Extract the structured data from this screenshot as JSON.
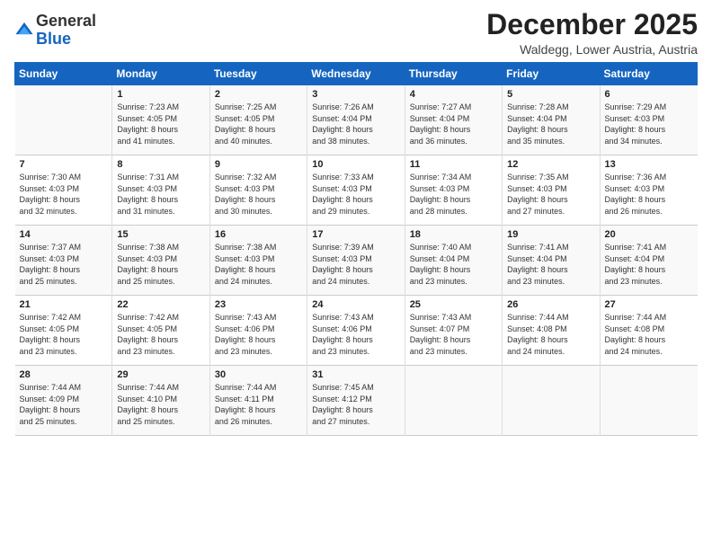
{
  "header": {
    "logo_general": "General",
    "logo_blue": "Blue",
    "month_title": "December 2025",
    "location": "Waldegg, Lower Austria, Austria"
  },
  "days_of_week": [
    "Sunday",
    "Monday",
    "Tuesday",
    "Wednesday",
    "Thursday",
    "Friday",
    "Saturday"
  ],
  "weeks": [
    [
      {
        "day": "",
        "info": ""
      },
      {
        "day": "1",
        "info": "Sunrise: 7:23 AM\nSunset: 4:05 PM\nDaylight: 8 hours\nand 41 minutes."
      },
      {
        "day": "2",
        "info": "Sunrise: 7:25 AM\nSunset: 4:05 PM\nDaylight: 8 hours\nand 40 minutes."
      },
      {
        "day": "3",
        "info": "Sunrise: 7:26 AM\nSunset: 4:04 PM\nDaylight: 8 hours\nand 38 minutes."
      },
      {
        "day": "4",
        "info": "Sunrise: 7:27 AM\nSunset: 4:04 PM\nDaylight: 8 hours\nand 36 minutes."
      },
      {
        "day": "5",
        "info": "Sunrise: 7:28 AM\nSunset: 4:04 PM\nDaylight: 8 hours\nand 35 minutes."
      },
      {
        "day": "6",
        "info": "Sunrise: 7:29 AM\nSunset: 4:03 PM\nDaylight: 8 hours\nand 34 minutes."
      }
    ],
    [
      {
        "day": "7",
        "info": "Sunrise: 7:30 AM\nSunset: 4:03 PM\nDaylight: 8 hours\nand 32 minutes."
      },
      {
        "day": "8",
        "info": "Sunrise: 7:31 AM\nSunset: 4:03 PM\nDaylight: 8 hours\nand 31 minutes."
      },
      {
        "day": "9",
        "info": "Sunrise: 7:32 AM\nSunset: 4:03 PM\nDaylight: 8 hours\nand 30 minutes."
      },
      {
        "day": "10",
        "info": "Sunrise: 7:33 AM\nSunset: 4:03 PM\nDaylight: 8 hours\nand 29 minutes."
      },
      {
        "day": "11",
        "info": "Sunrise: 7:34 AM\nSunset: 4:03 PM\nDaylight: 8 hours\nand 28 minutes."
      },
      {
        "day": "12",
        "info": "Sunrise: 7:35 AM\nSunset: 4:03 PM\nDaylight: 8 hours\nand 27 minutes."
      },
      {
        "day": "13",
        "info": "Sunrise: 7:36 AM\nSunset: 4:03 PM\nDaylight: 8 hours\nand 26 minutes."
      }
    ],
    [
      {
        "day": "14",
        "info": "Sunrise: 7:37 AM\nSunset: 4:03 PM\nDaylight: 8 hours\nand 25 minutes."
      },
      {
        "day": "15",
        "info": "Sunrise: 7:38 AM\nSunset: 4:03 PM\nDaylight: 8 hours\nand 25 minutes."
      },
      {
        "day": "16",
        "info": "Sunrise: 7:38 AM\nSunset: 4:03 PM\nDaylight: 8 hours\nand 24 minutes."
      },
      {
        "day": "17",
        "info": "Sunrise: 7:39 AM\nSunset: 4:03 PM\nDaylight: 8 hours\nand 24 minutes."
      },
      {
        "day": "18",
        "info": "Sunrise: 7:40 AM\nSunset: 4:04 PM\nDaylight: 8 hours\nand 23 minutes."
      },
      {
        "day": "19",
        "info": "Sunrise: 7:41 AM\nSunset: 4:04 PM\nDaylight: 8 hours\nand 23 minutes."
      },
      {
        "day": "20",
        "info": "Sunrise: 7:41 AM\nSunset: 4:04 PM\nDaylight: 8 hours\nand 23 minutes."
      }
    ],
    [
      {
        "day": "21",
        "info": "Sunrise: 7:42 AM\nSunset: 4:05 PM\nDaylight: 8 hours\nand 23 minutes."
      },
      {
        "day": "22",
        "info": "Sunrise: 7:42 AM\nSunset: 4:05 PM\nDaylight: 8 hours\nand 23 minutes."
      },
      {
        "day": "23",
        "info": "Sunrise: 7:43 AM\nSunset: 4:06 PM\nDaylight: 8 hours\nand 23 minutes."
      },
      {
        "day": "24",
        "info": "Sunrise: 7:43 AM\nSunset: 4:06 PM\nDaylight: 8 hours\nand 23 minutes."
      },
      {
        "day": "25",
        "info": "Sunrise: 7:43 AM\nSunset: 4:07 PM\nDaylight: 8 hours\nand 23 minutes."
      },
      {
        "day": "26",
        "info": "Sunrise: 7:44 AM\nSunset: 4:08 PM\nDaylight: 8 hours\nand 24 minutes."
      },
      {
        "day": "27",
        "info": "Sunrise: 7:44 AM\nSunset: 4:08 PM\nDaylight: 8 hours\nand 24 minutes."
      }
    ],
    [
      {
        "day": "28",
        "info": "Sunrise: 7:44 AM\nSunset: 4:09 PM\nDaylight: 8 hours\nand 25 minutes."
      },
      {
        "day": "29",
        "info": "Sunrise: 7:44 AM\nSunset: 4:10 PM\nDaylight: 8 hours\nand 25 minutes."
      },
      {
        "day": "30",
        "info": "Sunrise: 7:44 AM\nSunset: 4:11 PM\nDaylight: 8 hours\nand 26 minutes."
      },
      {
        "day": "31",
        "info": "Sunrise: 7:45 AM\nSunset: 4:12 PM\nDaylight: 8 hours\nand 27 minutes."
      },
      {
        "day": "",
        "info": ""
      },
      {
        "day": "",
        "info": ""
      },
      {
        "day": "",
        "info": ""
      }
    ]
  ]
}
